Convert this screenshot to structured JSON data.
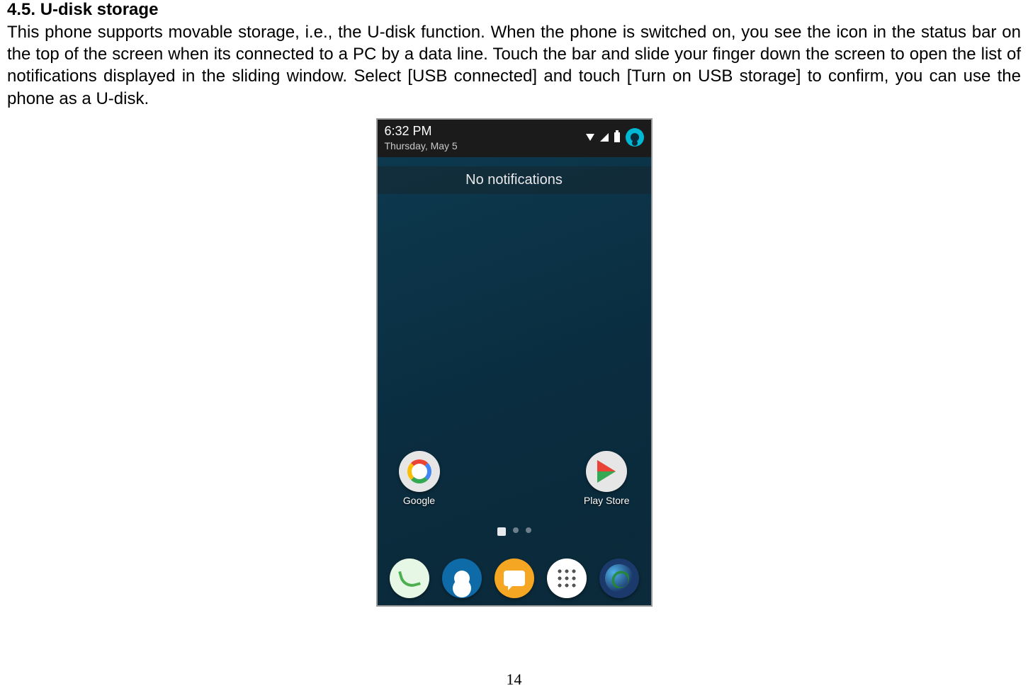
{
  "doc": {
    "heading": "4.5. U-disk storage",
    "body": "This phone supports movable storage, i.e., the U-disk function. When the phone is switched on, you see the icon in the status bar on the top of the screen when its connected to a PC by a data line. Touch the bar and slide your finger down the screen to open the list of notifications displayed in the sliding window. Select [USB connected] and touch [Turn on USB storage] to confirm, you can use the phone as a U-disk.",
    "page_number": "14"
  },
  "phone": {
    "time": "6:32 PM",
    "date": "Thursday, May 5",
    "no_notifications": "No notifications",
    "apps": {
      "google": "Google",
      "play_store": "Play Store"
    }
  }
}
